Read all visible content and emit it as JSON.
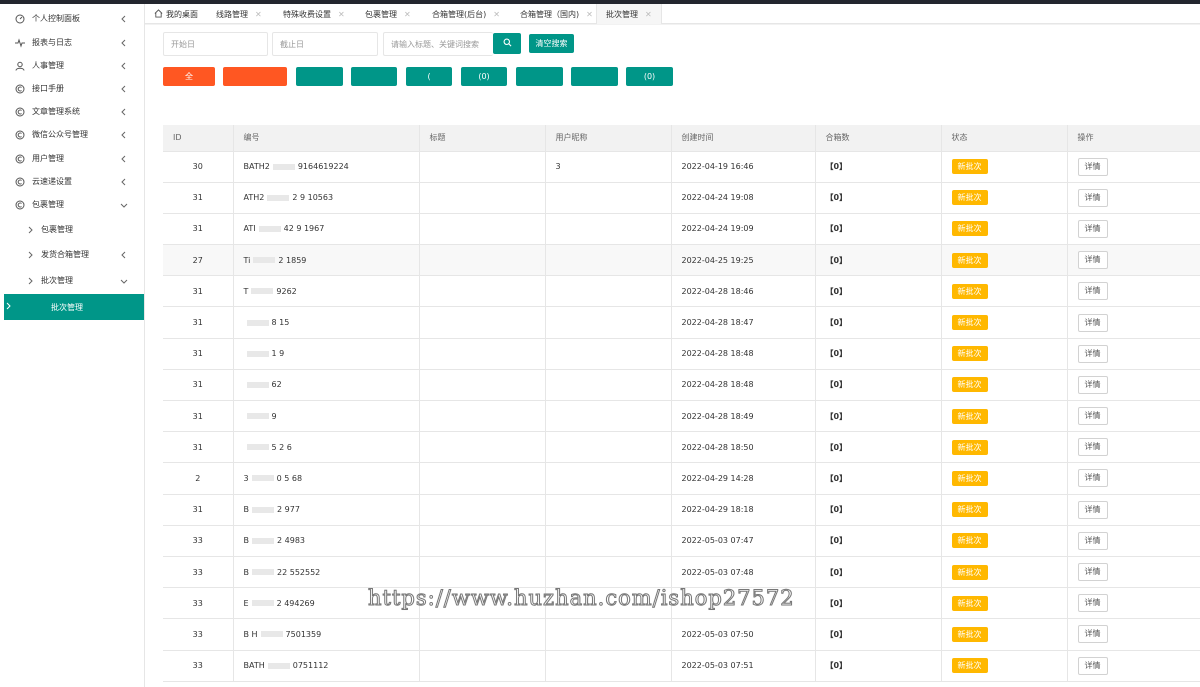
{
  "sidebar": {
    "items": [
      {
        "label": "个人控制面板",
        "icon": "dashboard-icon"
      },
      {
        "label": "报表与日志",
        "icon": "pulse-icon"
      },
      {
        "label": "人事管理",
        "icon": "user-icon"
      },
      {
        "label": "接口手册",
        "icon": "circle-c-icon"
      },
      {
        "label": "文章管理系统",
        "icon": "circle-c-icon"
      },
      {
        "label": "微信公众号管理",
        "icon": "circle-c-icon"
      },
      {
        "label": "用户管理",
        "icon": "circle-c-icon"
      },
      {
        "label": "云速递设置",
        "icon": "circle-c-icon"
      },
      {
        "label": "包裹管理",
        "icon": "circle-c-icon"
      }
    ],
    "sub_items": [
      {
        "label": "包裹管理"
      },
      {
        "label": "发货合箱管理"
      },
      {
        "label": "批次管理"
      }
    ],
    "active_item": "批次管理"
  },
  "tabs": [
    {
      "label": "我的桌面"
    },
    {
      "label": "线路管理"
    },
    {
      "label": "特殊收费设置"
    },
    {
      "label": "包裹管理"
    },
    {
      "label": "合箱管理(后台)"
    },
    {
      "label": "合箱管理（国内)"
    },
    {
      "label": "批次管理"
    }
  ],
  "search": {
    "start_placeholder": "开始日",
    "end_placeholder": "截止日",
    "keyword_placeholder": "请输入标题、关键词搜索",
    "clear_label": "清空搜索"
  },
  "filters": [
    "全",
    "",
    "",
    "",
    "(",
    "(0)",
    "",
    "",
    "(0)"
  ],
  "table": {
    "headers": [
      "ID",
      "编号",
      "标题",
      "用户昵称",
      "创建时间",
      "合箱数",
      "状态",
      "操作"
    ],
    "rows": [
      {
        "id": "30",
        "code": "BATH2",
        "code2": "9164619224",
        "title": "",
        "user": "3",
        "time": "2022-04-19 16:46",
        "count": "【0】",
        "status": "新批次",
        "action": "详情"
      },
      {
        "id": "31",
        "code": "ATH2",
        "code2": "2 9 10563",
        "title": "",
        "user": "",
        "time": "2022-04-24 19:08",
        "count": "【0】",
        "status": "新批次",
        "action": "详情"
      },
      {
        "id": "31",
        "code": "ATI",
        "code2": "42 9 1967",
        "title": "",
        "user": "",
        "time": "2022-04-24 19:09",
        "count": "【0】",
        "status": "新批次",
        "action": "详情"
      },
      {
        "id": "27",
        "code": "Ti",
        "code2": "2 1859",
        "title": "",
        "user": "",
        "time": "2022-04-25 19:25",
        "count": "【0】",
        "status": "新批次",
        "action": "详情"
      },
      {
        "id": "31",
        "code": "T",
        "code2": "9262",
        "title": "",
        "user": "",
        "time": "2022-04-28 18:46",
        "count": "【0】",
        "status": "新批次",
        "action": "详情"
      },
      {
        "id": "31",
        "code": "",
        "code2": "8 15",
        "title": "",
        "user": "",
        "time": "2022-04-28 18:47",
        "count": "【0】",
        "status": "新批次",
        "action": "详情"
      },
      {
        "id": "31",
        "code": "",
        "code2": "1 9",
        "title": "",
        "user": "",
        "time": "2022-04-28 18:48",
        "count": "【0】",
        "status": "新批次",
        "action": "详情"
      },
      {
        "id": "31",
        "code": "",
        "code2": "62",
        "title": "",
        "user": "",
        "time": "2022-04-28 18:48",
        "count": "【0】",
        "status": "新批次",
        "action": "详情"
      },
      {
        "id": "31",
        "code": "",
        "code2": "9",
        "title": "",
        "user": "",
        "time": "2022-04-28 18:49",
        "count": "【0】",
        "status": "新批次",
        "action": "详情"
      },
      {
        "id": "31",
        "code": "",
        "code2": "5 2 6",
        "title": "",
        "user": "",
        "time": "2022-04-28 18:50",
        "count": "【0】",
        "status": "新批次",
        "action": "详情"
      },
      {
        "id": "2",
        "code": "3",
        "code2": "0 5 68",
        "title": "",
        "user": "",
        "time": "2022-04-29 14:28",
        "count": "【0】",
        "status": "新批次",
        "action": "详情"
      },
      {
        "id": "31",
        "code": "B",
        "code2": "2 977",
        "title": "",
        "user": "",
        "time": "2022-04-29 18:18",
        "count": "【0】",
        "status": "新批次",
        "action": "详情"
      },
      {
        "id": "33",
        "code": "B",
        "code2": "2 4983",
        "title": "",
        "user": "",
        "time": "2022-05-03 07:47",
        "count": "【0】",
        "status": "新批次",
        "action": "详情"
      },
      {
        "id": "33",
        "code": "B",
        "code2": "22 552552",
        "title": "",
        "user": "",
        "time": "2022-05-03 07:48",
        "count": "【0】",
        "status": "新批次",
        "action": "详情"
      },
      {
        "id": "33",
        "code": "E",
        "code2": "2 494269",
        "title": "",
        "user": "",
        "time": "",
        "count": "【0】",
        "status": "新批次",
        "action": "详情"
      },
      {
        "id": "33",
        "code": "B H",
        "code2": "7501359",
        "title": "",
        "user": "",
        "time": "2022-05-03 07:50",
        "count": "【0】",
        "status": "新批次",
        "action": "详情"
      },
      {
        "id": "33",
        "code": "BATH",
        "code2": "0751112",
        "title": "",
        "user": "",
        "time": "2022-05-03 07:51",
        "count": "【0】",
        "status": "新批次",
        "action": "详情"
      }
    ]
  },
  "watermark": "https://www.huzhan.com/ishop27572",
  "colors": {
    "accent": "#009688",
    "danger": "#ff5722",
    "warning": "#ffb800",
    "sidebar_bg": "#ffffff"
  }
}
